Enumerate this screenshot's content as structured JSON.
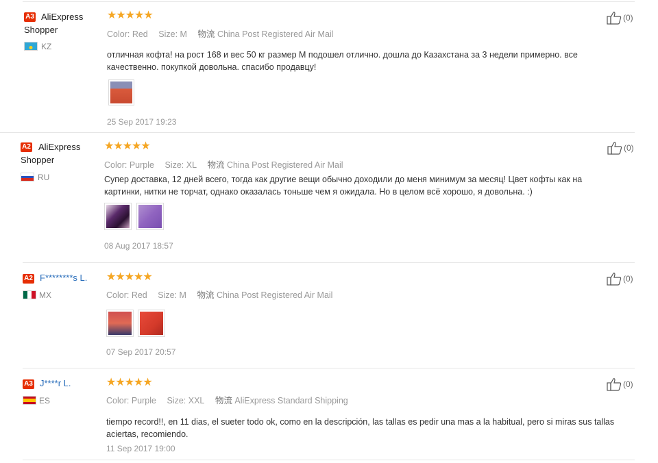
{
  "reviews": [
    {
      "badge": "A3",
      "name": "AliExpress",
      "name2": "Shopper",
      "country": "KZ",
      "stars": "★★★★★",
      "color_label": "Color:",
      "color_value": "Red",
      "size_label": "Size:",
      "size_value": "M",
      "shipping_label": "物流",
      "shipping_value": "China Post Registered Air Mail",
      "text": "отличная кофта! на рост 168 и вес 50 кг размер М подошел отлично. дошла до Казахстана за 3 недели примерно. все качественно. покупкой довольна. спасибо продавцу!",
      "date": "25 Sep 2017 19:23",
      "likes": "(0)"
    },
    {
      "badge": "A2",
      "name": "AliExpress",
      "name2": "Shopper",
      "country": "RU",
      "stars": "★★★★★",
      "color_label": "Color:",
      "color_value": "Purple",
      "size_label": "Size:",
      "size_value": "XL",
      "shipping_label": "物流",
      "shipping_value": "China Post Registered Air Mail",
      "text": "Супер доставка, 12 дней всего, тогда как другие вещи обычно доходили до меня минимум за месяц! Цвет кофты как на картинки, нитки не торчат, однако оказалась тоньше чем я ожидала. Но в целом всё хорошо, я довольна. :)",
      "date": "08 Aug 2017 18:57",
      "likes": "(0)"
    },
    {
      "badge": "A2",
      "name": "F********s L.",
      "country": "MX",
      "stars": "★★★★★",
      "color_label": "Color:",
      "color_value": "Red",
      "size_label": "Size:",
      "size_value": "M",
      "shipping_label": "物流",
      "shipping_value": "China Post Registered Air Mail",
      "date": "07 Sep 2017 20:57",
      "likes": "(0)"
    },
    {
      "badge": "A3",
      "name": "J****r L.",
      "country": "ES",
      "stars": "★★★★★",
      "color_label": "Color:",
      "color_value": "Purple",
      "size_label": "Size:",
      "size_value": "XXL",
      "shipping_label": "物流",
      "shipping_value": "AliExpress Standard Shipping",
      "text": "tiempo record!!, en 11 dias, el sueter todo ok, como en la descripción, las tallas es pedir una mas a la habitual, pero si miras sus tallas aciertas, recomiendo.",
      "date": "11 Sep 2017 19:00",
      "likes": "(0)"
    }
  ],
  "colors": {
    "badge": "#e62e04",
    "star": "#f5a623",
    "link": "#2a6ebb"
  },
  "icons": {
    "like": "thumbs-up-icon"
  }
}
